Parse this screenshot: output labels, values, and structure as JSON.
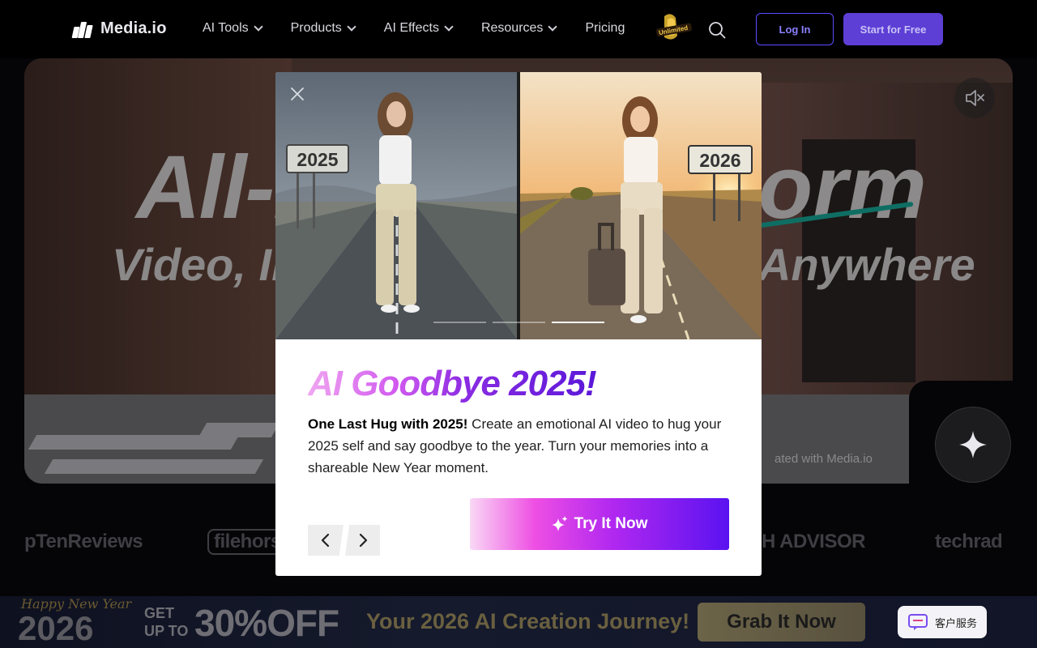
{
  "nav": {
    "brand": "Media.io",
    "menu": [
      {
        "label": "AI Tools",
        "dropdown": true
      },
      {
        "label": "Products",
        "dropdown": true
      },
      {
        "label": "AI Effects",
        "dropdown": true
      },
      {
        "label": "Resources",
        "dropdown": true
      },
      {
        "label": "Pricing",
        "dropdown": false
      }
    ],
    "badge_text": "Unlimited",
    "login_label": "Log In",
    "start_label": "Start for Free"
  },
  "hero": {
    "title_left": "All-i",
    "title_right": "orm",
    "subtitle_left": "Video, Ima",
    "subtitle_right": "Anywhere",
    "created_with": "ated with Media.io"
  },
  "modal": {
    "sign_left": "2025",
    "sign_right": "2026",
    "slide_count": 3,
    "active_slide": 3,
    "title": "AI Goodbye 2025!",
    "desc_bold": "One Last Hug with 2025!",
    "desc_rest": " Create an emotional AI video to hug your 2025 self and say goodbye to the year. Turn your memories into a shareable New Year moment.",
    "cta_label": "Try It Now"
  },
  "logos": [
    "pTenReviews",
    "filehorse",
    "H ADVISOR",
    "techrad"
  ],
  "promo": {
    "greeting": "Happy New Year",
    "year": "2026",
    "get": "GET",
    "upto": "UP TO",
    "discount": "30%OFF",
    "tagline": "Your 2026 AI Creation Journey!",
    "cta_label": "Grab It Now"
  },
  "support": {
    "label": "客户服务"
  },
  "colors": {
    "accent": "#5d3fd6",
    "title_gradient_start": "#f0a6f0",
    "title_gradient_end": "#5a18d8",
    "cta_gradient_end": "#5a12f0"
  }
}
